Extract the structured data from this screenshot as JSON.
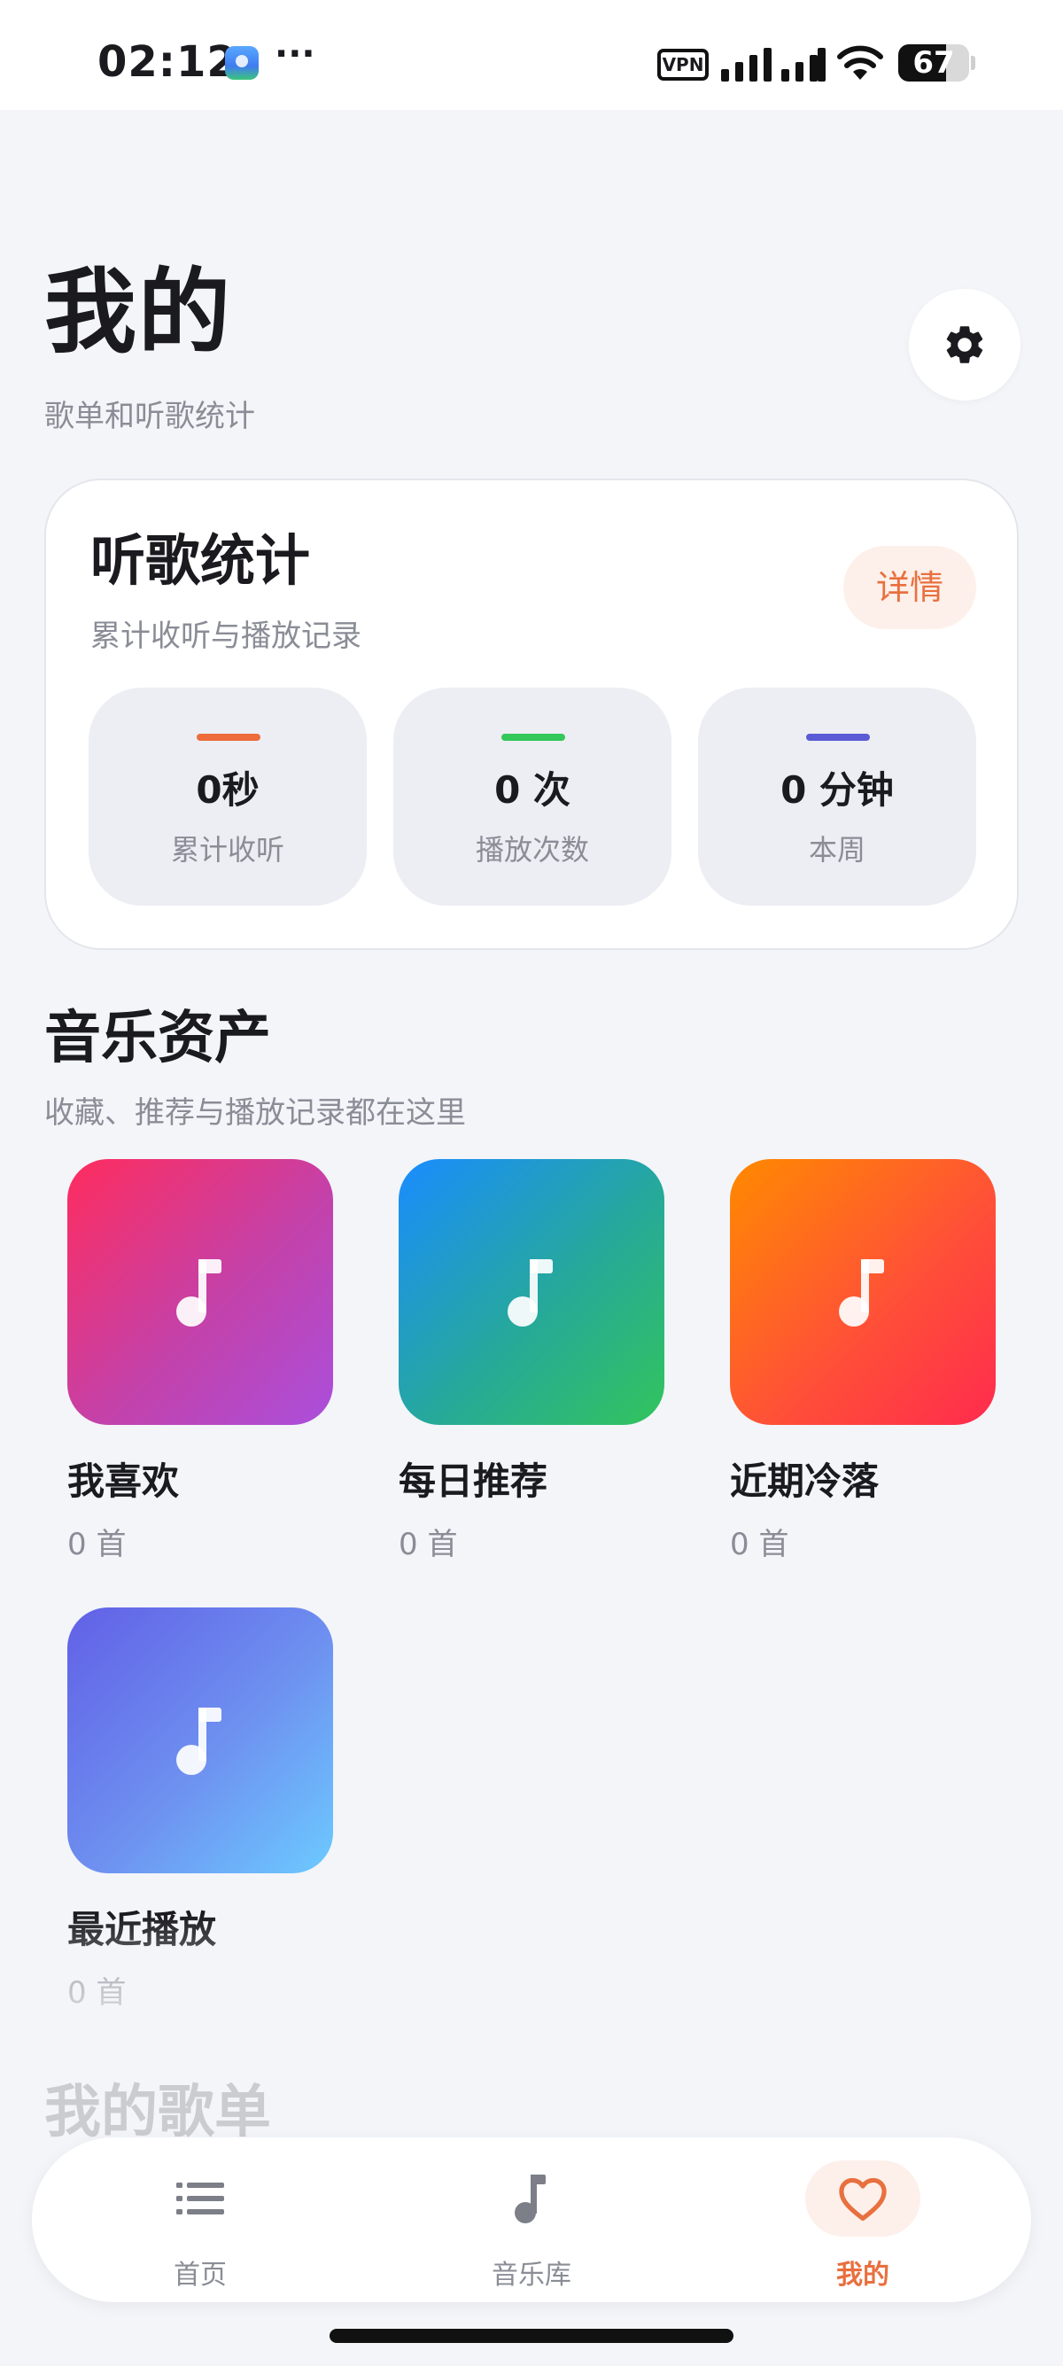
{
  "status_bar": {
    "time": "02:12",
    "more": "···",
    "vpn_label": "VPN",
    "battery_level": "67",
    "battery_fraction": 0.67
  },
  "header": {
    "title": "我的",
    "subtitle": "歌单和听歌统计",
    "settings_icon": "gear-icon"
  },
  "stats": {
    "title": "听歌统计",
    "subtitle": "累计收听与播放记录",
    "detail_label": "详情",
    "items": [
      {
        "value": "0秒",
        "label": "累计收听",
        "color": "#ee6c3c"
      },
      {
        "value": "0 次",
        "label": "播放次数",
        "color": "#34c759"
      },
      {
        "value": "0 分钟",
        "label": "本周",
        "color": "#5b5bd6"
      }
    ]
  },
  "assets": {
    "title": "音乐资产",
    "subtitle": "收藏、推荐与播放记录都在这里",
    "items": [
      {
        "name": "我喜欢",
        "count": "0 首",
        "icon": "music-note-icon"
      },
      {
        "name": "每日推荐",
        "count": "0 首",
        "icon": "music-note-icon"
      },
      {
        "name": "近期冷落",
        "count": "0 首",
        "icon": "music-note-icon"
      },
      {
        "name": "最近播放",
        "count": "0 首",
        "icon": "music-note-icon"
      }
    ]
  },
  "next_section": {
    "title": "我的歌单"
  },
  "tabbar": {
    "items": [
      {
        "label": "首页",
        "icon": "list-icon",
        "active": false
      },
      {
        "label": "音乐库",
        "icon": "music-note-icon",
        "active": false
      },
      {
        "label": "我的",
        "icon": "heart-icon",
        "active": true
      }
    ],
    "accent": "#e8703f"
  }
}
